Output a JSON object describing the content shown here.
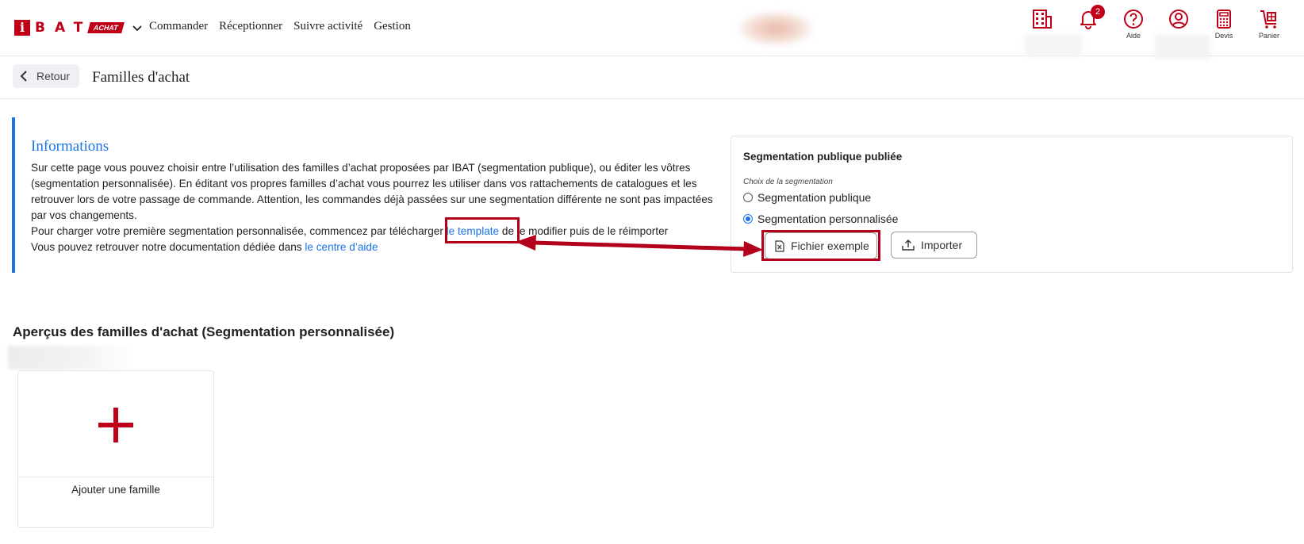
{
  "header": {
    "logo": {
      "letter": "i",
      "text": "BAT",
      "badge": "ACHAT"
    },
    "nav": [
      "Commander",
      "Réceptionner",
      "Suivre activité",
      "Gestion"
    ],
    "icons": {
      "notifications_count": "2",
      "aide_label": "Aide",
      "devis_label": "Devis",
      "panier_label": "Panier"
    }
  },
  "subheader": {
    "back_label": "Retour",
    "title": "Familles d'achat"
  },
  "info": {
    "title": "Informations",
    "text1": "Sur cette page vous pouvez choisir entre l’utilisation des familles d’achat proposées par IBAT (segmentation publique), ou éditer les vôtres (segmentation personnalisée). En éditant vos propres familles d’achat vous pourrez les utiliser dans vos rattachements de catalogues et les retrouver lors de votre passage de commande. Attention, les commandes déjà passées sur une segmentation différente ne sont pas impactées par vos changements.",
    "text2_before": "Pour charger votre première segmentation personnalisée, commencez par télécharger ",
    "text2_link": "le template",
    "text2_after": " de le modifier puis de le réimporter",
    "text3_before": "Vous pouvez retrouver notre documentation dédiée dans ",
    "text3_link": "le centre d’aide"
  },
  "segmentation": {
    "title": "Segmentation publique publiée",
    "subtitle": "Choix de la segmentation",
    "options": [
      {
        "label": "Segmentation publique",
        "checked": false
      },
      {
        "label": "Segmentation personnalisée",
        "checked": true
      }
    ],
    "example_button": "Fichier exemple",
    "import_button": "Importer"
  },
  "families": {
    "title": "Aperçus des familles d'achat (Segmentation personnalisée)",
    "add_label": "Ajouter une famille"
  },
  "colors": {
    "brand_red": "#c00018",
    "link_blue": "#1a73e8",
    "annotation_red": "#b3001b"
  }
}
